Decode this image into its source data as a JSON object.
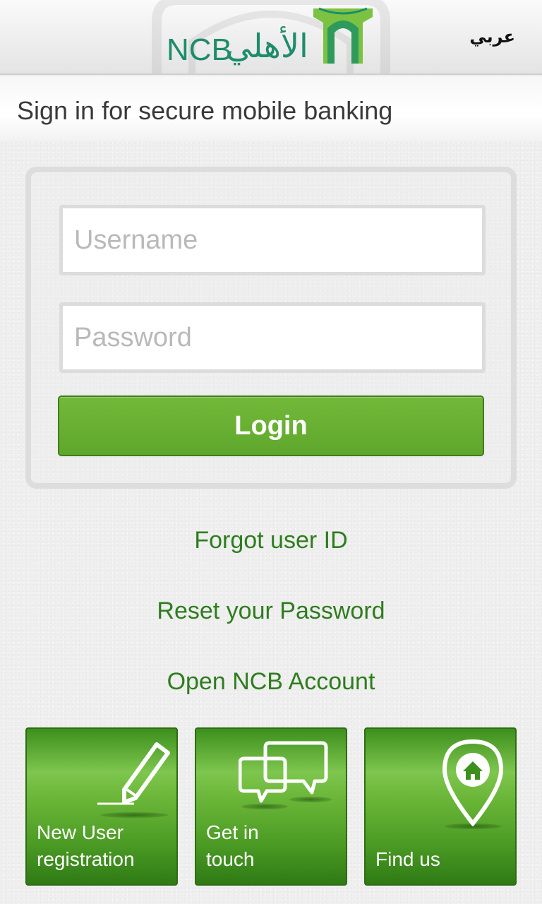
{
  "header": {
    "logo_latin": "NCB",
    "logo_arabic": "الأهلي",
    "language_toggle": "عربي"
  },
  "subheader": {
    "title": "Sign in for secure mobile banking"
  },
  "login_form": {
    "username_placeholder": "Username",
    "password_placeholder": "Password",
    "login_label": "Login"
  },
  "links": {
    "forgot_user_id": "Forgot user ID",
    "reset_password": "Reset your Password",
    "open_account": "Open NCB Account"
  },
  "tiles": {
    "new_user": {
      "line1": "New User",
      "line2": "registration",
      "icon": "pencil-icon"
    },
    "get_in_touch": {
      "line1": "Get in",
      "line2": "touch",
      "icon": "chat-bubbles-icon"
    },
    "find_us": {
      "line1": "Find us",
      "icon": "location-pin-icon"
    }
  },
  "colors": {
    "brand_green": "#1e8c6c",
    "button_green": "#6ab333",
    "link_green": "#2e7d1e",
    "logo_mark_green": "#7cc242"
  }
}
